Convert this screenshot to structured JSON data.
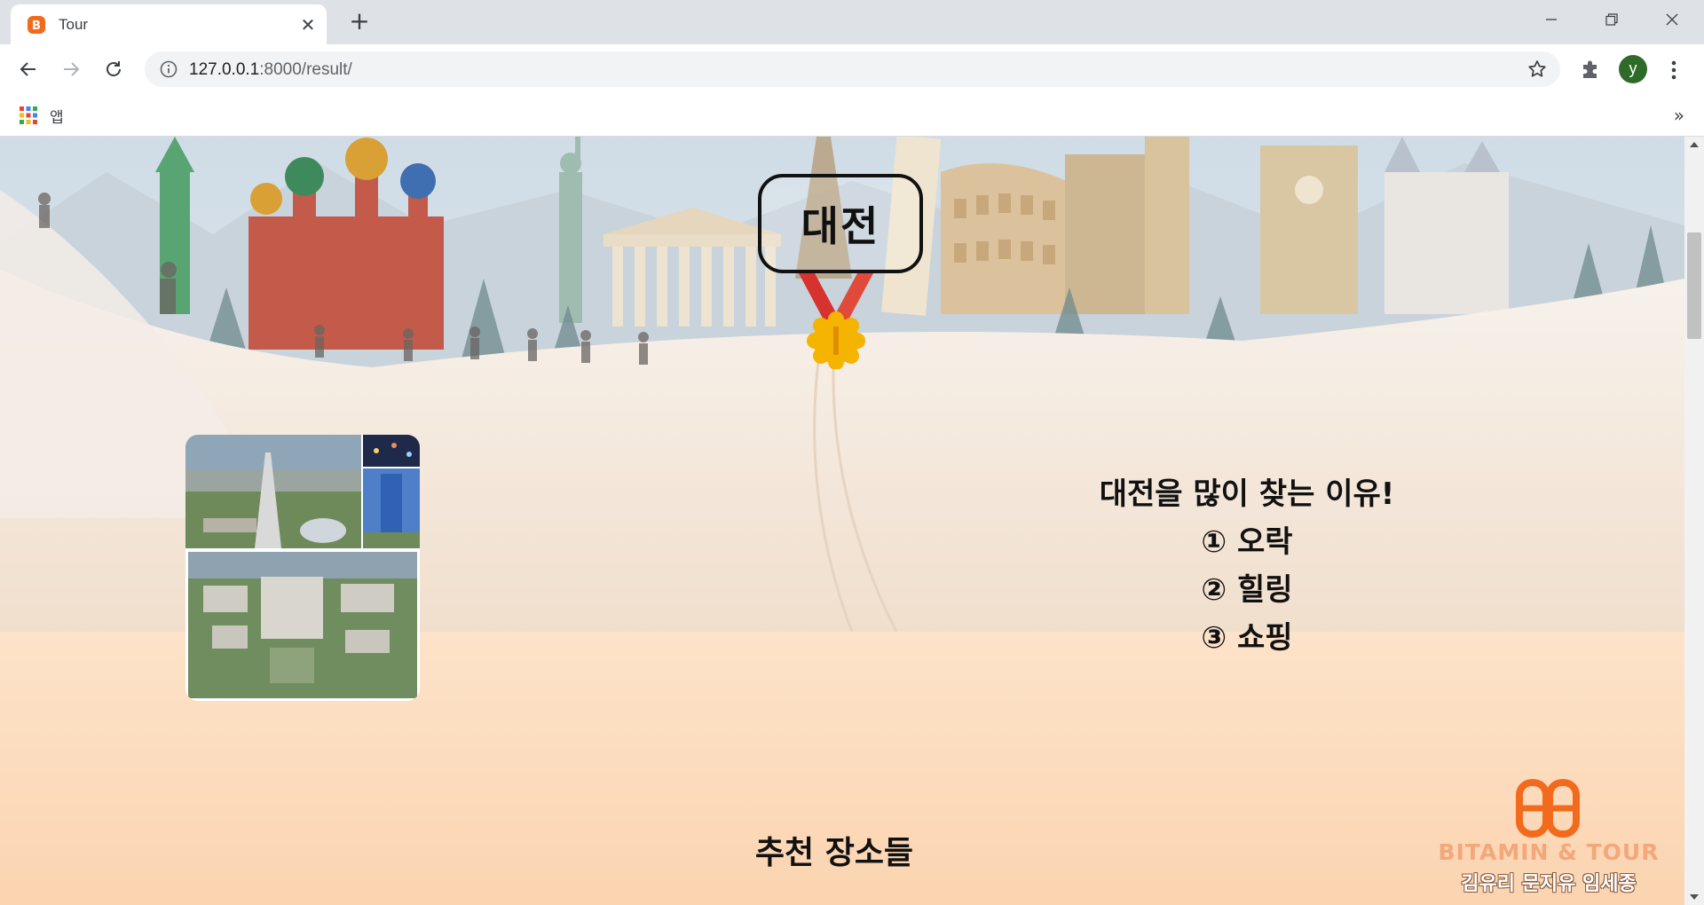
{
  "browser": {
    "tab_title": "Tour",
    "url_host": "127.0.0.1",
    "url_path": ":8000/result/",
    "bookmarks_apps_label": "앱",
    "bookmarks_more": "»",
    "profile_initial": "y",
    "new_tab_symbol": "+",
    "close_tab_symbol": "✕"
  },
  "page": {
    "city_name": "대전",
    "reasons_title": "대전을 많이 찾는 이유!",
    "reasons": [
      "① 오락",
      "② 힐링",
      "③ 쇼핑"
    ],
    "recommend_title": "추천 장소들",
    "brand_name": "BITAMIN & TOUR",
    "brand_authors": "김유리 문지유 임세종"
  },
  "icons": {
    "favicon": "bb-logo-icon",
    "back": "back-arrow-icon",
    "forward": "forward-arrow-icon",
    "reload": "reload-icon",
    "site_info": "info-icon",
    "bookmark_star": "star-icon",
    "extensions": "puzzle-icon",
    "menu": "kebab-menu-icon",
    "apps": "apps-grid-icon",
    "medal": "gold-medal-icon"
  },
  "colors": {
    "tabstrip": "#dee1e6",
    "accent_orange": "#f26b1d",
    "page_lower_bg": "#fde0c5",
    "medal_ribbon": "#d6332f",
    "medal_gold": "#f5b400",
    "profile": "#2e6b28"
  }
}
